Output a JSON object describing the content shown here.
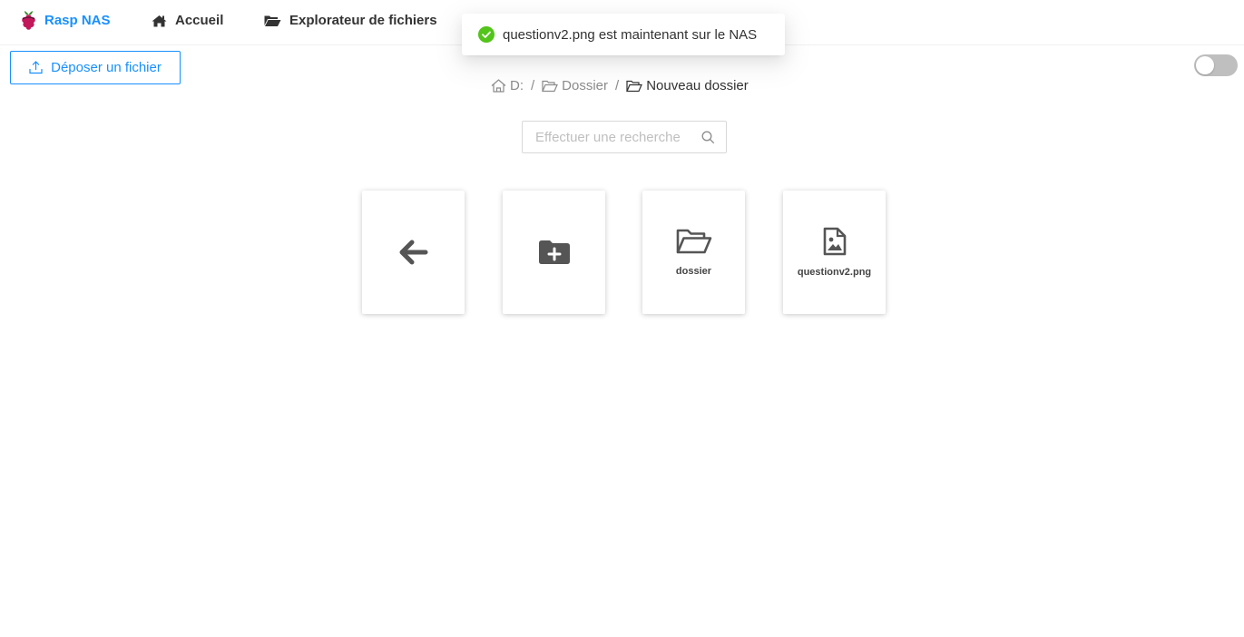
{
  "header": {
    "brand": "Rasp NAS",
    "nav": [
      {
        "label": "Accueil",
        "icon": "home-icon"
      },
      {
        "label": "Explorateur de fichiers",
        "icon": "folder-open-icon"
      }
    ],
    "accent_color": "#1890ff"
  },
  "toast": {
    "message": "questionv2.png est maintenant sur le NAS",
    "icon": "check-circle-icon",
    "status_color": "#52c41a"
  },
  "toolbar": {
    "upload_label": "Déposer un fichier",
    "theme_toggle": {
      "checked": false
    }
  },
  "breadcrumb": {
    "root": "D:",
    "separator": "/",
    "items": [
      "Dossier",
      "Nouveau dossier"
    ]
  },
  "search": {
    "placeholder": "Effectuer une recherche",
    "value": ""
  },
  "items": [
    {
      "type": "back",
      "icon": "arrow-left-icon"
    },
    {
      "type": "new-folder",
      "icon": "folder-plus-icon"
    },
    {
      "type": "folder",
      "label": "dossier",
      "icon": "folder-open-icon"
    },
    {
      "type": "file",
      "label": "questionv2.png",
      "icon": "file-image-icon"
    }
  ]
}
